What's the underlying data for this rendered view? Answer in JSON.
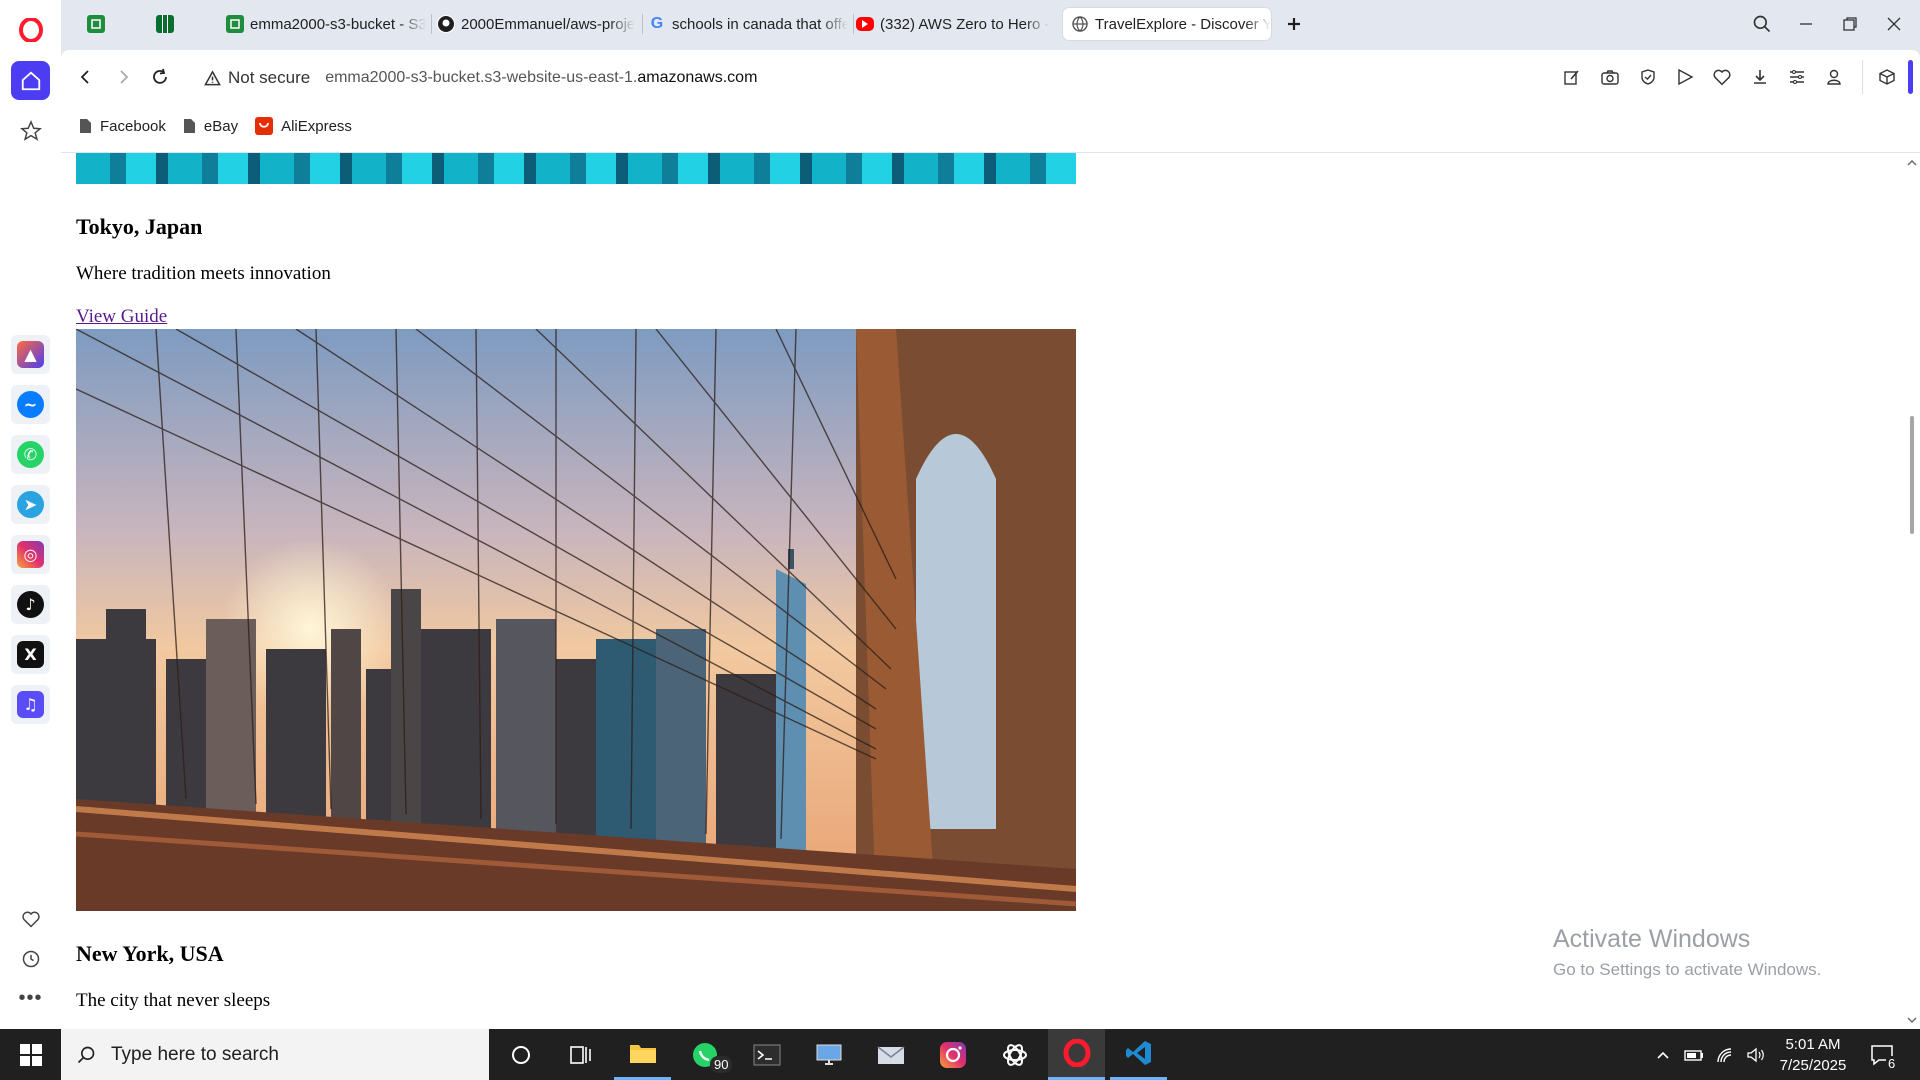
{
  "browser": {
    "tabs": [
      {
        "label": "",
        "active": false
      },
      {
        "label": "",
        "active": false
      },
      {
        "label": "emma2000-s3-bucket - S3",
        "active": false
      },
      {
        "label": "2000Emmanuel/aws-proje",
        "active": false
      },
      {
        "label": "schools in canada that offe",
        "active": false
      },
      {
        "label": "(332) AWS Zero to Hero -",
        "active": false
      },
      {
        "label": "TravelExplore - Discover Yo",
        "active": true
      }
    ],
    "security_label": "Not secure",
    "url_prefix": "emma2000-s3-bucket.s3-website-us-east-1.",
    "url_domain": "amazonaws.com",
    "bookmarks": [
      "Facebook",
      "eBay",
      "AliExpress"
    ]
  },
  "page": {
    "destinations": [
      {
        "name": "Tokyo, Japan",
        "tagline": "Where tradition meets innovation",
        "link": "View Guide"
      },
      {
        "name": "New York, USA",
        "tagline": "The city that never sleeps"
      }
    ]
  },
  "watermark": {
    "title": "Activate Windows",
    "subtitle": "Go to Settings to activate Windows."
  },
  "taskbar": {
    "search_placeholder": "Type here to search",
    "whatsapp_badge": "90",
    "time": "5:01 AM",
    "date": "7/25/2025",
    "notification_count": "6"
  },
  "colors": {
    "accent": "#4c3df2",
    "opera_red": "#ff1b2d",
    "link_visited": "#551a8b",
    "taskbar": "#202020"
  }
}
